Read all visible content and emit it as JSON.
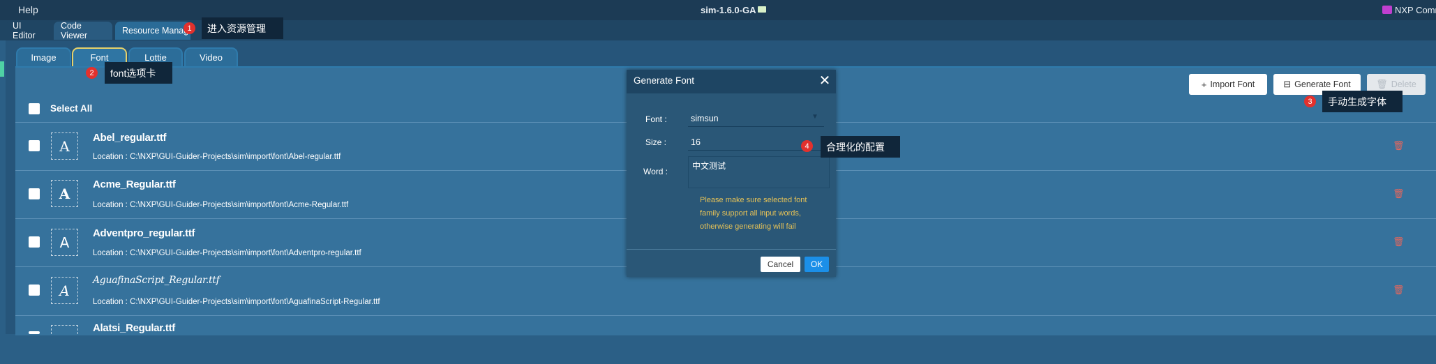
{
  "topbar": {
    "help_label": "Help",
    "title": "sim-1.6.0-GA",
    "nxp_label": "NXP Comm"
  },
  "main_tabs": [
    {
      "label": "UI Editor"
    },
    {
      "label": "Code Viewer"
    },
    {
      "label": "Resource Manage"
    }
  ],
  "sub_tabs": [
    {
      "label": "Image"
    },
    {
      "label": "Font",
      "active": true
    },
    {
      "label": "Lottie"
    },
    {
      "label": "Video"
    }
  ],
  "toolbar": {
    "import_label": "Import Font",
    "generate_label": "Generate Font",
    "delete_label": "Delete"
  },
  "select_all_label": "Select All",
  "fonts": [
    {
      "glyph": "A",
      "name": "Abel_regular.ttf",
      "location": "Location : C:\\NXP\\GUI-Guider-Projects\\sim\\import\\font\\Abel-regular.ttf"
    },
    {
      "glyph": "A",
      "name": "Acme_Regular.ttf",
      "location": "Location : C:\\NXP\\GUI-Guider-Projects\\sim\\import\\font\\Acme-Regular.ttf"
    },
    {
      "glyph": "A",
      "name": "Adventpro_regular.ttf",
      "location": "Location : C:\\NXP\\GUI-Guider-Projects\\sim\\import\\font\\Adventpro-regular.ttf"
    },
    {
      "glyph": "A",
      "name": "AguafinaScript_Regular.ttf",
      "location": "Location : C:\\NXP\\GUI-Guider-Projects\\sim\\import\\font\\AguafinaScript-Regular.ttf"
    },
    {
      "glyph": "A",
      "name": "Alatsi_Regular.ttf",
      "location": ""
    }
  ],
  "dialog": {
    "title": "Generate Font",
    "close_label": "✕",
    "font_label": "Font :",
    "font_value": "simsun",
    "size_label": "Size :",
    "size_value": "16",
    "word_label": "Word :",
    "word_value": "中文测试",
    "warning": "Please make sure selected font family support all input words, otherwise generating will fail",
    "cancel_label": "Cancel",
    "ok_label": "OK"
  },
  "annotations": [
    {
      "num": "1",
      "text": "进入资源管理"
    },
    {
      "num": "2",
      "text": "font选项卡"
    },
    {
      "num": "3",
      "text": "手动生成字体"
    },
    {
      "num": "4",
      "text": "合理化的配置"
    }
  ],
  "colors": {
    "background": "#2b5f86",
    "panel": "#36729c",
    "accent_warning": "#e6c257",
    "ok_button": "#1b8fe8",
    "badge": "#e3312d",
    "trash": "#e5675d"
  }
}
